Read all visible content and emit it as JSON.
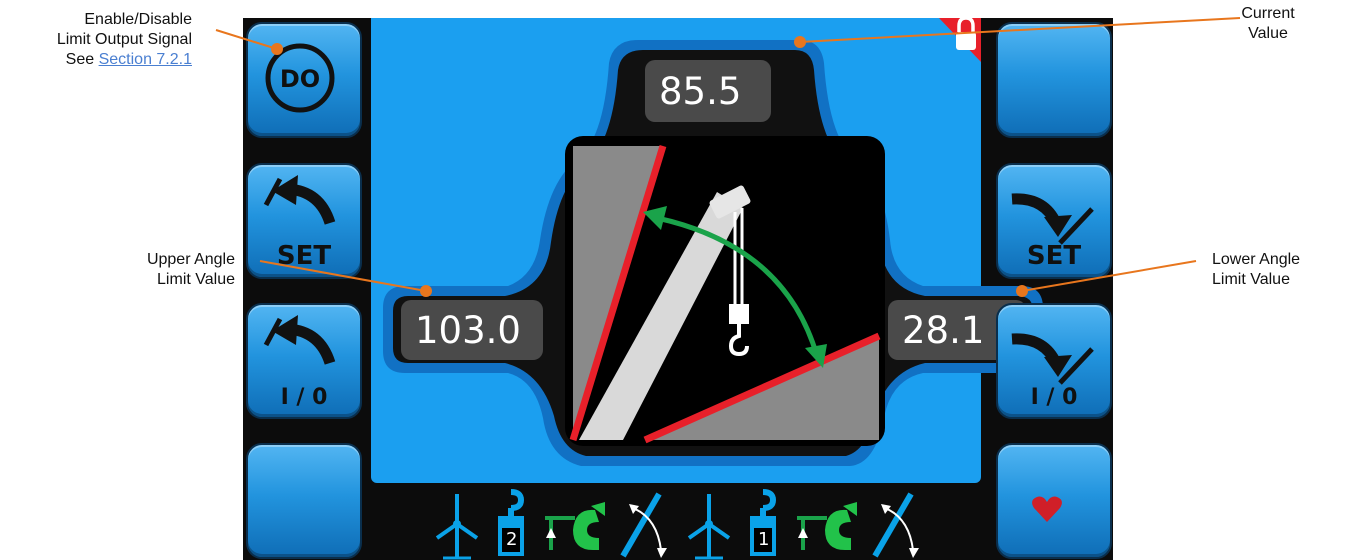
{
  "annotations": {
    "enable_disable": [
      "Enable/Disable",
      "Limit Output Signal"
    ],
    "see_prefix": "See",
    "section_link": "Section 7.2.1",
    "current_value": [
      "Current",
      "Value"
    ],
    "upper_angle": [
      "Upper Angle",
      "Limit Value"
    ],
    "lower_angle": [
      "Lower Angle",
      "Limit Value"
    ]
  },
  "display": {
    "current_value": "85.5",
    "upper_limit_value": "103.0",
    "lower_limit_value": "28.1",
    "limit_preview": {
      "upper_deg": 103.0,
      "lower_deg": 28.1,
      "current_deg": 85.5
    }
  },
  "buttons": {
    "left": {
      "do_label": "DO",
      "set_upper_label": "SET",
      "toggle_upper_label": "I / 0"
    },
    "right": {
      "set_lower_label": "SET",
      "toggle_lower_label": "I / 0"
    }
  },
  "status_bar": {
    "hoist_counts": [
      "2",
      "1"
    ],
    "icons": [
      "wind-turbine-icon",
      "hook-weight-icon",
      "hook-lift-icon",
      "boom-angle-icon",
      "wind-turbine-icon",
      "hook-weight-icon",
      "hook-lift-icon",
      "boom-angle-icon"
    ]
  },
  "colors": {
    "accent_blue": "#1b9ff0",
    "limit_red": "#e8202a",
    "sweep_green": "#1aa34a",
    "callout_orange": "#e8761d",
    "link_blue": "#4a7fd1"
  }
}
